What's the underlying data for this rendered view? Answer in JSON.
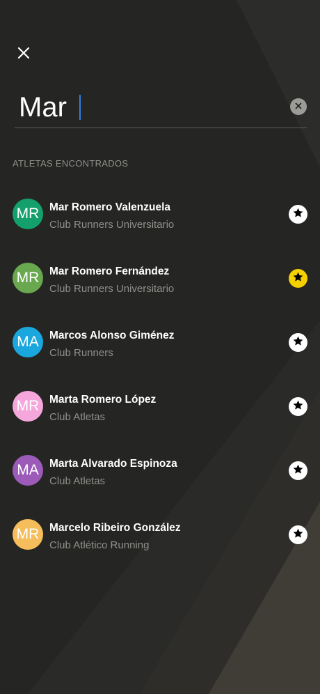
{
  "search": {
    "value": "Mar",
    "caret": "|"
  },
  "section_title": "ATLETAS ENCONTRADOS",
  "colors": {
    "caret": "#2f7de1",
    "favorite": "#f5d000",
    "star_off_bg": "#ffffff",
    "clear_bg": "#9b9b98"
  },
  "icons": {
    "close": "close-icon",
    "clear": "clear-icon",
    "star": "star-icon"
  },
  "athletes": [
    {
      "initials": "MR",
      "name": "Mar Romero Valenzuela",
      "club": "Club Runners Universitario",
      "avatar_color": "#14a06d",
      "favorite": false
    },
    {
      "initials": "MR",
      "name": "Mar Romero Fernández",
      "club": "Club Runners Universitario",
      "avatar_color": "#6aa84f",
      "favorite": true
    },
    {
      "initials": "MA",
      "name": "Marcos Alonso Giménez",
      "club": "Club Runners",
      "avatar_color": "#1aa7dd",
      "favorite": false
    },
    {
      "initials": "MR",
      "name": "Marta Romero López",
      "club": "Club Atletas",
      "avatar_color": "#f5a7dc",
      "favorite": false
    },
    {
      "initials": "MA",
      "name": "Marta Alvarado Espinoza",
      "club": "Club Atletas",
      "avatar_color": "#9c5bb8",
      "favorite": false
    },
    {
      "initials": "MR",
      "name": "Marcelo Ribeiro González",
      "club": "Club Atlético Running",
      "avatar_color": "#f5bd5b",
      "favorite": false
    }
  ]
}
